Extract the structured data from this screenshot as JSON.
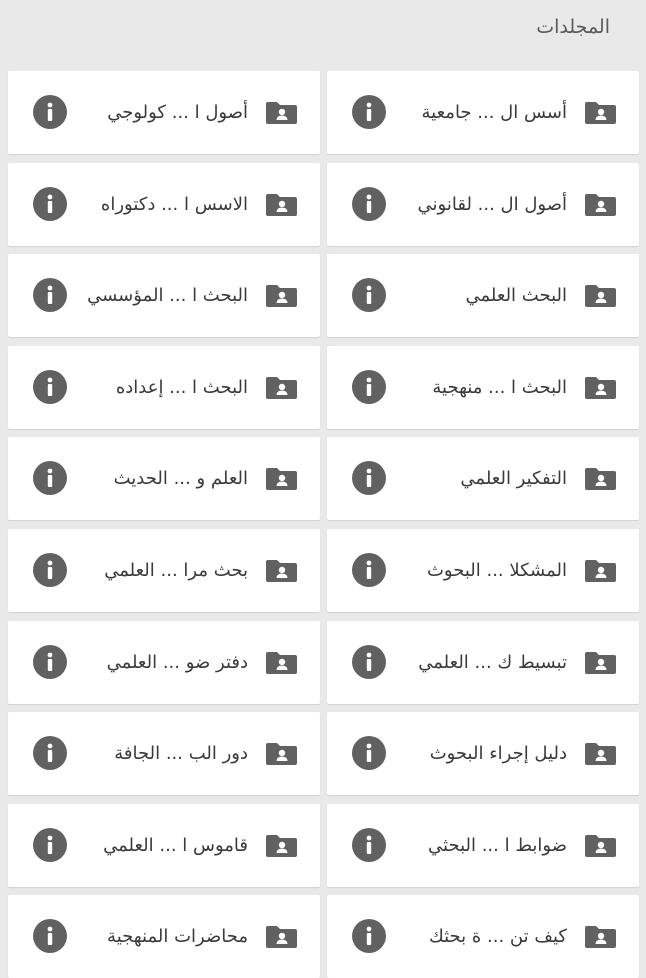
{
  "header": {
    "title": "المجلدات"
  },
  "rows": [
    {
      "right": "أسس ال ... جامعية",
      "left": "أصول ا ... كولوجي"
    },
    {
      "right": "أصول ال ... لقانوني",
      "left": "الاسس ا ... دكتوراه"
    },
    {
      "right": "البحث العلمي",
      "left": "البحث ا ... المؤسسي"
    },
    {
      "right": "البحث ا ... منهجية",
      "left": "البحث ا ... إعداده"
    },
    {
      "right": "التفكير العلمي",
      "left": "العلم و ... الحديث"
    },
    {
      "right": "المشكلا ... البحوث",
      "left": "بحث مرا ... العلمي"
    },
    {
      "right": "تبسيط ك ... العلمي",
      "left": "دفتر ضو ... العلمي"
    },
    {
      "right": "دليل إجراء البحوث",
      "left": "دور الب ... الجافة"
    },
    {
      "right": "ضوابط ا ... البحثي",
      "left": "قاموس ا ... العلمي"
    },
    {
      "right": "كيف تن ... ة بحثك",
      "left": "محاضرات المنهجية"
    }
  ],
  "icons": {
    "folder": "shared-folder-icon",
    "info": "info-icon"
  },
  "colors": {
    "background": "#e9e9e9",
    "card": "#ffffff",
    "icon": "#616161",
    "text": "#3a3a3a"
  }
}
